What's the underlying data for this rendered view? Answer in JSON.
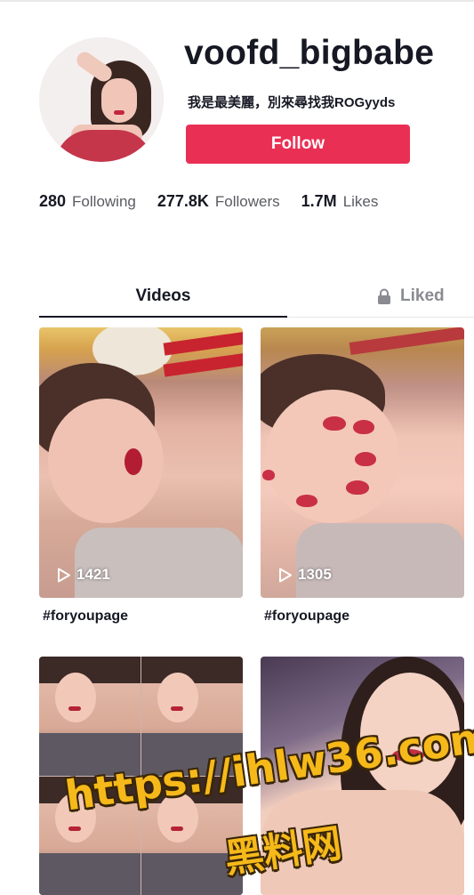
{
  "profile": {
    "username": "voofd_bigbabe",
    "bio": "我是最美麗，別來尋找我ROGyyds",
    "follow_label": "Follow"
  },
  "stats": [
    {
      "value": "280",
      "label": "Following"
    },
    {
      "value": "277.8K",
      "label": "Followers"
    },
    {
      "value": "1.7M",
      "label": "Likes"
    }
  ],
  "tabs": {
    "videos_label": "Videos",
    "liked_label": "Liked"
  },
  "videos": [
    {
      "views": "1421",
      "caption": "#foryoupage"
    },
    {
      "views": "1305",
      "caption": "#foryoupage"
    },
    {
      "views": "",
      "caption": ""
    },
    {
      "views": "",
      "caption": ""
    }
  ],
  "watermark": {
    "url": "https://ihlw36.com",
    "text": "黑料网"
  },
  "colors": {
    "follow_button": "#ea2f55",
    "text_primary": "#161823",
    "text_secondary": "#5a5b62",
    "watermark": "#f6b91a"
  },
  "icons": {
    "liked_tab": "lock-icon",
    "views": "play-icon"
  }
}
